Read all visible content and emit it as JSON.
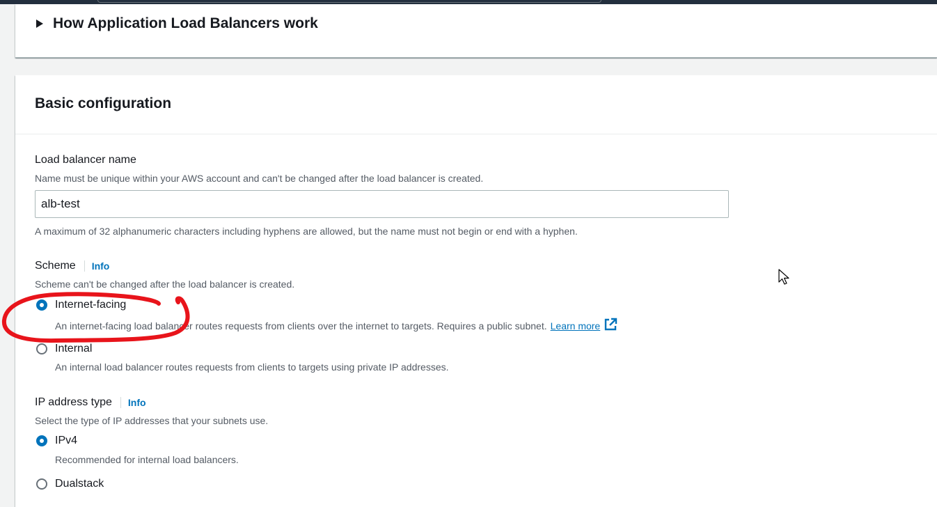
{
  "how_section": {
    "title": "How Application Load Balancers work"
  },
  "basic_config": {
    "title": "Basic configuration",
    "load_balancer_name": {
      "label": "Load balancer name",
      "description": "Name must be unique within your AWS account and can't be changed after the load balancer is created.",
      "value": "alb-test",
      "constraint": "A maximum of 32 alphanumeric characters including hyphens are allowed, but the name must not begin or end with a hyphen."
    },
    "scheme": {
      "label": "Scheme",
      "info": "Info",
      "description": "Scheme can't be changed after the load balancer is created.",
      "options": [
        {
          "label": "Internet-facing",
          "description": "An internet-facing load balancer routes requests from clients over the internet to targets. Requires a public subnet.",
          "link": "Learn more",
          "selected": true
        },
        {
          "label": "Internal",
          "description": "An internal load balancer routes requests from clients to targets using private IP addresses.",
          "selected": false
        }
      ]
    },
    "ip_address_type": {
      "label": "IP address type",
      "info": "Info",
      "description": "Select the type of IP addresses that your subnets use.",
      "options": [
        {
          "label": "IPv4",
          "description": "Recommended for internal load balancers.",
          "selected": true
        },
        {
          "label": "Dualstack",
          "selected": false
        }
      ]
    }
  },
  "colors": {
    "accent": "#0073bb",
    "annotation": "#e8141b",
    "header_bar": "#232f3e"
  }
}
